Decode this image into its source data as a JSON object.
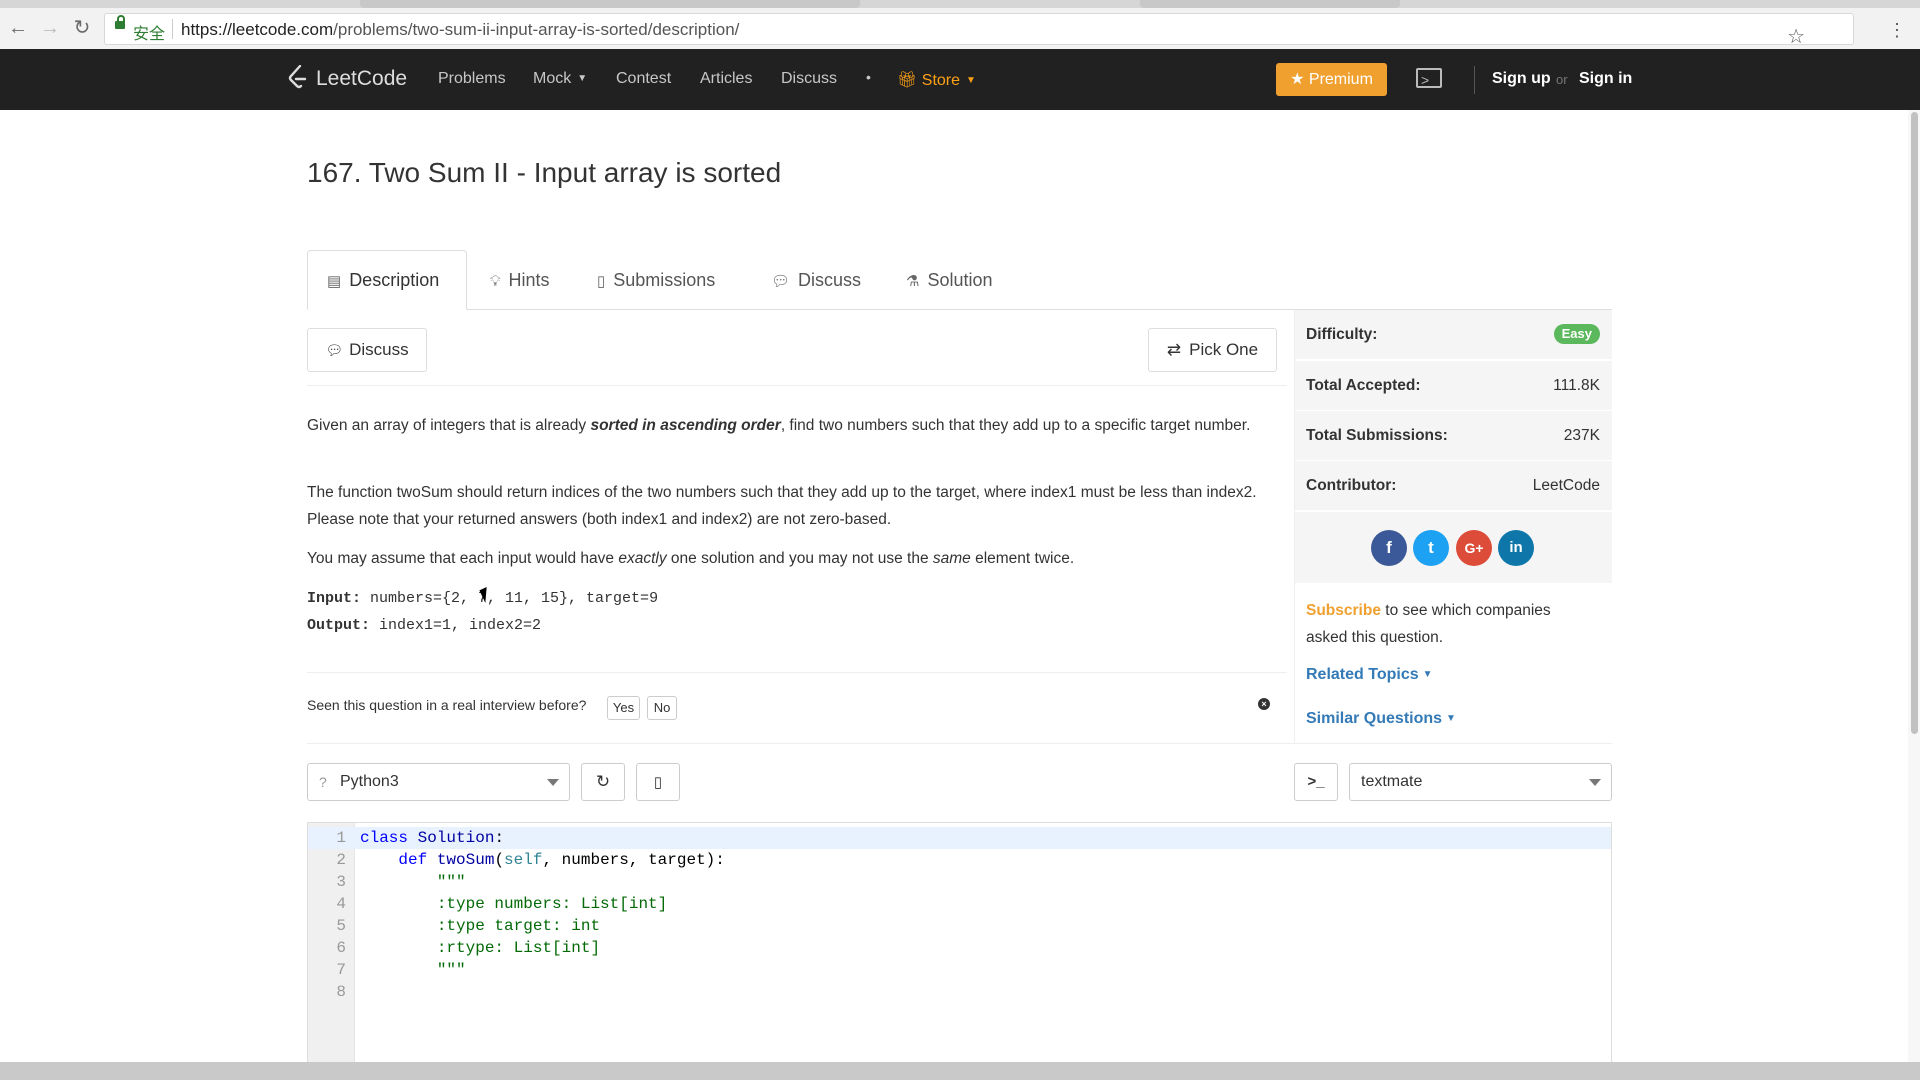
{
  "browser": {
    "secure_label": "安全",
    "url_scheme_host": "https://leetcode.com",
    "url_path": "/problems/two-sum-ii-input-array-is-sorted/description/"
  },
  "header": {
    "logo_text": "LeetCode",
    "nav": [
      "Problems",
      "Mock",
      "Contest",
      "Articles",
      "Discuss"
    ],
    "dot": "•",
    "store": "Store",
    "premium": "Premium",
    "signup": "Sign up",
    "or": "or",
    "signin": "Sign in"
  },
  "problem": {
    "title": "167. Two Sum II - Input array is sorted",
    "tabs": [
      "Description",
      "Hints",
      "Submissions",
      "Discuss",
      "Solution"
    ],
    "discuss_button": "Discuss",
    "pick_one_button": "Pick One",
    "p1_a": "Given an array of integers that is already ",
    "p1_b": "sorted in ascending order",
    "p1_c": ", find two numbers such that they add up to a specific target number.",
    "p2": "The function twoSum should return indices of the two numbers such that they add up to the target, where index1 must be less than index2. Please note that your returned answers (both index1 and index2) are not zero-based.",
    "p3_a": "You may assume that each input would have ",
    "p3_b": "exactly",
    "p3_c": " one solution and you may not use the ",
    "p3_d": "same",
    "p3_e": " element twice.",
    "input_label": "Input:",
    "input_value": " numbers={2, 7, 11, 15}, target=9",
    "output_label": "Output:",
    "output_value": " index1=1, index2=2",
    "interview_q": "Seen this question in a real interview before?",
    "yes": "Yes",
    "no": "No"
  },
  "sidebar": {
    "difficulty_label": "Difficulty:",
    "difficulty_value": "Easy",
    "accepted_label": "Total Accepted:",
    "accepted_value": "111.8K",
    "submissions_label": "Total Submissions:",
    "submissions_value": "237K",
    "contributor_label": "Contributor:",
    "contributor_value": "LeetCode",
    "subscribe": "Subscribe",
    "subscribe_rest": " to see which companies asked this question.",
    "related_topics": "Related Topics",
    "similar_questions": "Similar Questions",
    "social": [
      "f",
      "t",
      "G+",
      "in"
    ]
  },
  "editor": {
    "language": "Python3",
    "theme": "textmate",
    "console_icon": ">_",
    "lines": [
      {
        "n": "1",
        "code": "class Solution:"
      },
      {
        "n": "2",
        "code": "    def twoSum(self, numbers, target):"
      },
      {
        "n": "3",
        "code": "        \"\"\""
      },
      {
        "n": "4",
        "code": "        :type numbers: List[int]"
      },
      {
        "n": "5",
        "code": "        :type target: int"
      },
      {
        "n": "6",
        "code": "        :rtype: List[int]"
      },
      {
        "n": "7",
        "code": "        \"\"\""
      },
      {
        "n": "8",
        "code": ""
      }
    ]
  },
  "colors": {
    "header_bg": "#212121",
    "premium": "#f0a02e",
    "easy": "#5cb85c",
    "link": "#337ab7"
  }
}
